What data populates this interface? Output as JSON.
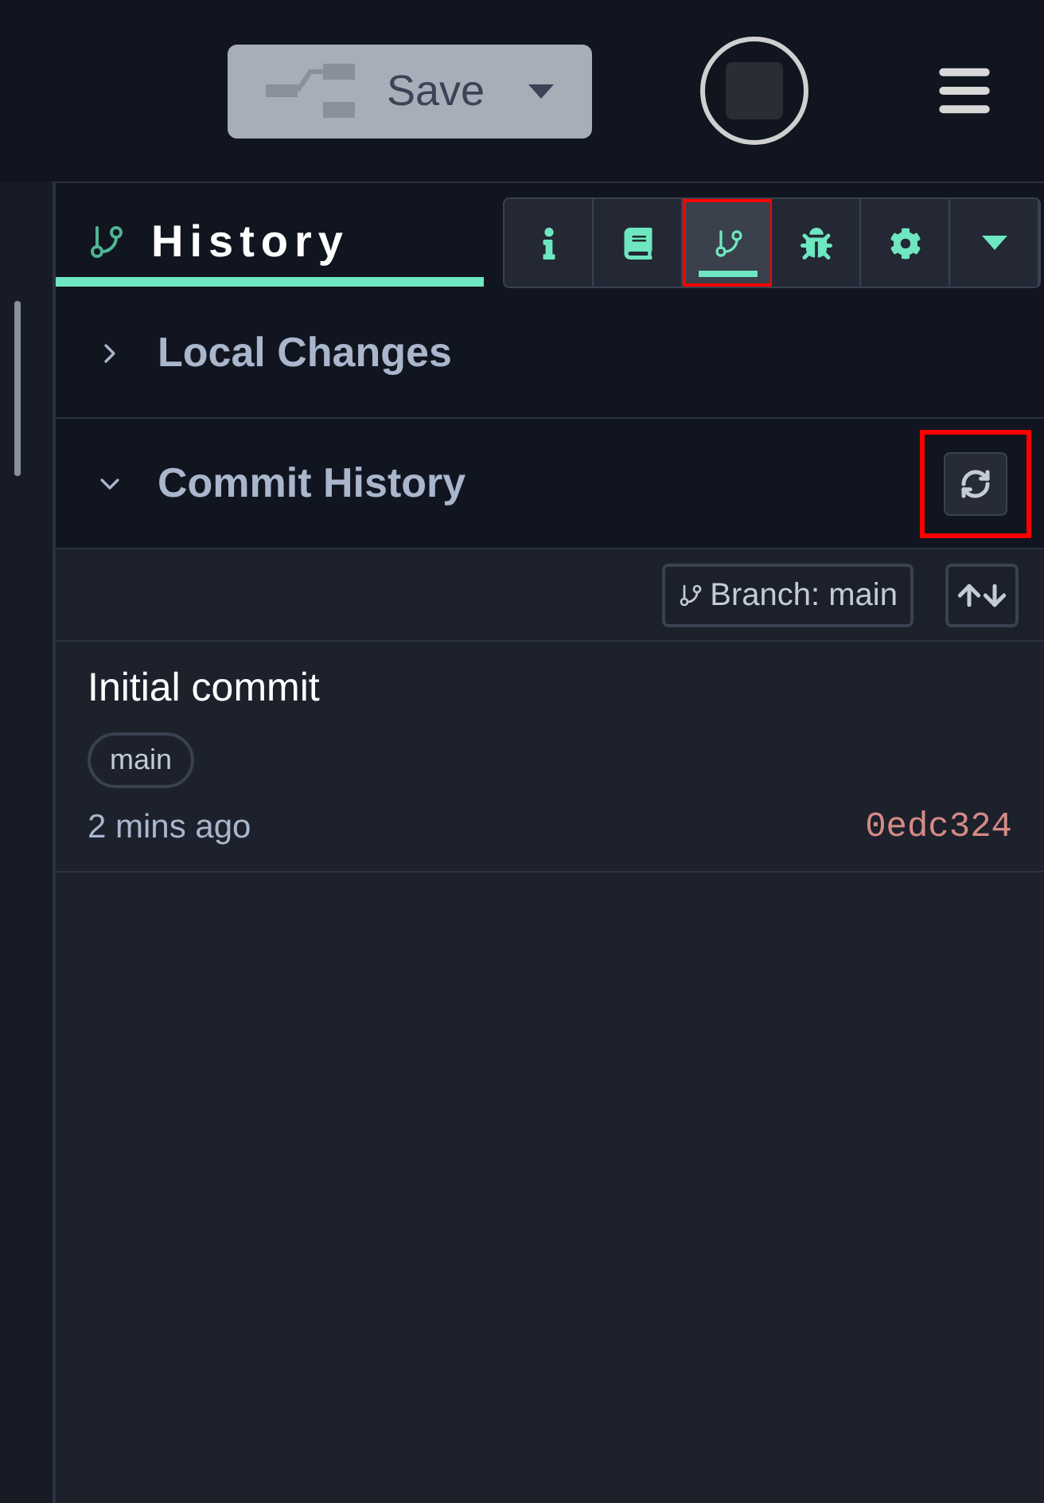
{
  "topbar": {
    "save_label": "Save"
  },
  "panel": {
    "title": "History",
    "tools": [
      {
        "kind": "info",
        "selected": false
      },
      {
        "kind": "book",
        "selected": false
      },
      {
        "kind": "branch",
        "selected": true
      },
      {
        "kind": "bug",
        "selected": false
      },
      {
        "kind": "settings",
        "selected": false
      },
      {
        "kind": "more",
        "selected": false
      }
    ],
    "sections": [
      {
        "title": "Local Changes",
        "expanded": false,
        "refresh": false
      },
      {
        "title": "Commit History",
        "expanded": true,
        "refresh": true
      }
    ],
    "branch_label": "Branch: main",
    "commits": [
      {
        "message": "Initial commit",
        "tags": [
          "main"
        ],
        "time": "2 mins ago",
        "hash": "0edc324"
      }
    ]
  }
}
